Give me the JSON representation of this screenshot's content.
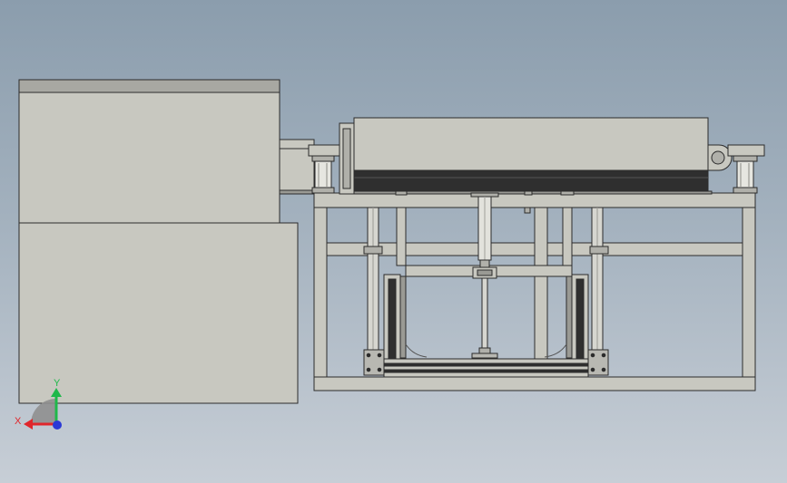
{
  "view": {
    "background_top": "#8b9dad",
    "background_bottom": "#c7ced6",
    "part_fill": "#c8c8c0",
    "edge_color": "#2b2b2b",
    "belt_color": "#2f2f2f"
  },
  "triad": {
    "x_label": "X",
    "y_label": "Y",
    "x_color": "#e0262b",
    "y_color": "#1fb84a",
    "z_color": "#2a38d6"
  }
}
